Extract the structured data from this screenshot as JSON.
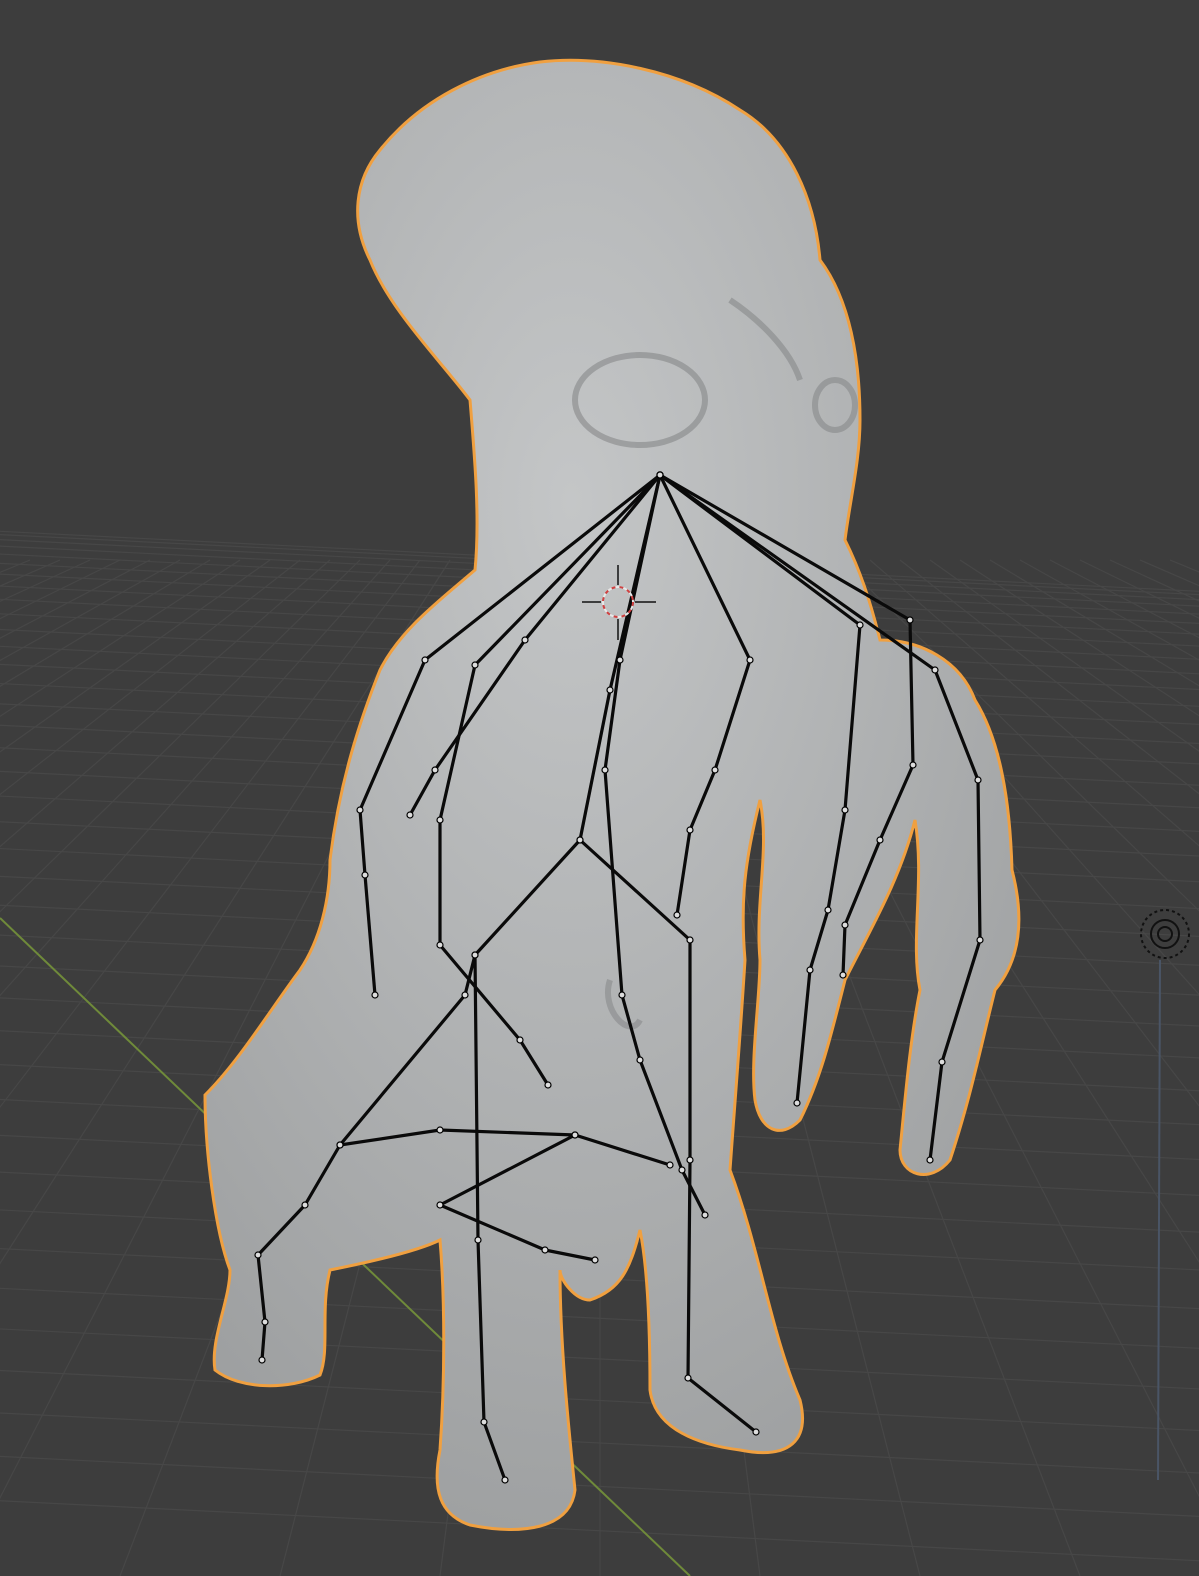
{
  "viewport": {
    "view": "3d-viewport",
    "mode": "object",
    "colors": {
      "background": "#3d3d3d",
      "grid": "#474747",
      "x_axis": "#6f8a3a",
      "z_axis": "#4a5566",
      "mesh": "#b5b7b8",
      "mesh_shadow": "#8e9091",
      "selection_outline": "#f0a040",
      "bone": "#0a0a0a",
      "cursor_red": "#d04040",
      "cursor_white": "#e8e8e8"
    },
    "icons": {
      "cursor": "3d-cursor-icon",
      "light": "light-gizmo-icon"
    },
    "objects": [
      {
        "name": "creature-mesh",
        "selected": true
      },
      {
        "name": "armature",
        "display": "stick"
      }
    ]
  }
}
